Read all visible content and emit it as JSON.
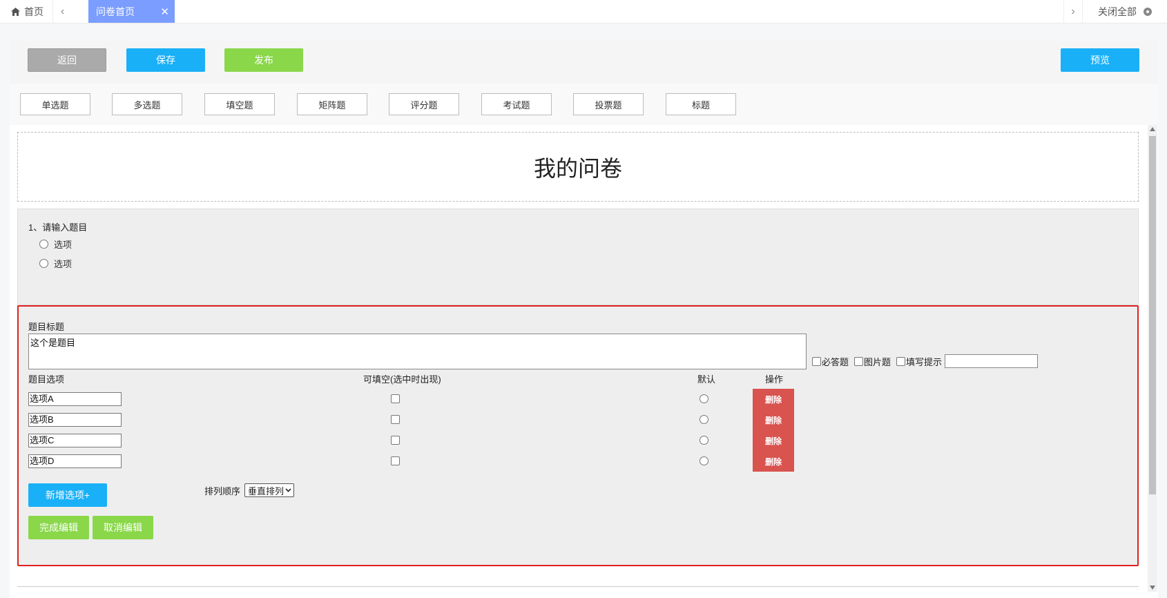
{
  "tabs": {
    "home": "首页",
    "active": "问卷首页",
    "close_all": "关闭全部"
  },
  "toolbar": {
    "back": "返回",
    "save": "保存",
    "publish": "发布",
    "preview": "预览"
  },
  "question_types": [
    "单选题",
    "多选题",
    "填空题",
    "矩阵题",
    "评分题",
    "考试题",
    "投票题",
    "标题"
  ],
  "survey_title": "我的问卷",
  "preview_question": {
    "title": "1、请输入题目",
    "options": [
      "选项",
      "选项"
    ]
  },
  "editor": {
    "title_label": "题目标题",
    "title_value": "这个是题目",
    "required_label": "必答题",
    "image_label": "图片题",
    "hint_label": "填写提示",
    "hint_value": "",
    "options_header": "题目选项",
    "fillable_header": "可填空(选中时出现)",
    "default_header": "默认",
    "action_header": "操作",
    "options": [
      {
        "value": "选项A",
        "delete": "删除"
      },
      {
        "value": "选项B",
        "delete": "删除"
      },
      {
        "value": "选项C",
        "delete": "删除"
      },
      {
        "value": "选项D",
        "delete": "删除"
      }
    ],
    "add_option": "新增选项+",
    "order_label": "排列顺序",
    "order_value": "垂直排列",
    "done": "完成编辑",
    "cancel": "取消编辑"
  },
  "colors": {
    "tab_active": "#7b9dff",
    "primary": "#1ab0f7",
    "green": "#8ad74a",
    "danger": "#d9534f",
    "editor_border": "#e02020"
  }
}
